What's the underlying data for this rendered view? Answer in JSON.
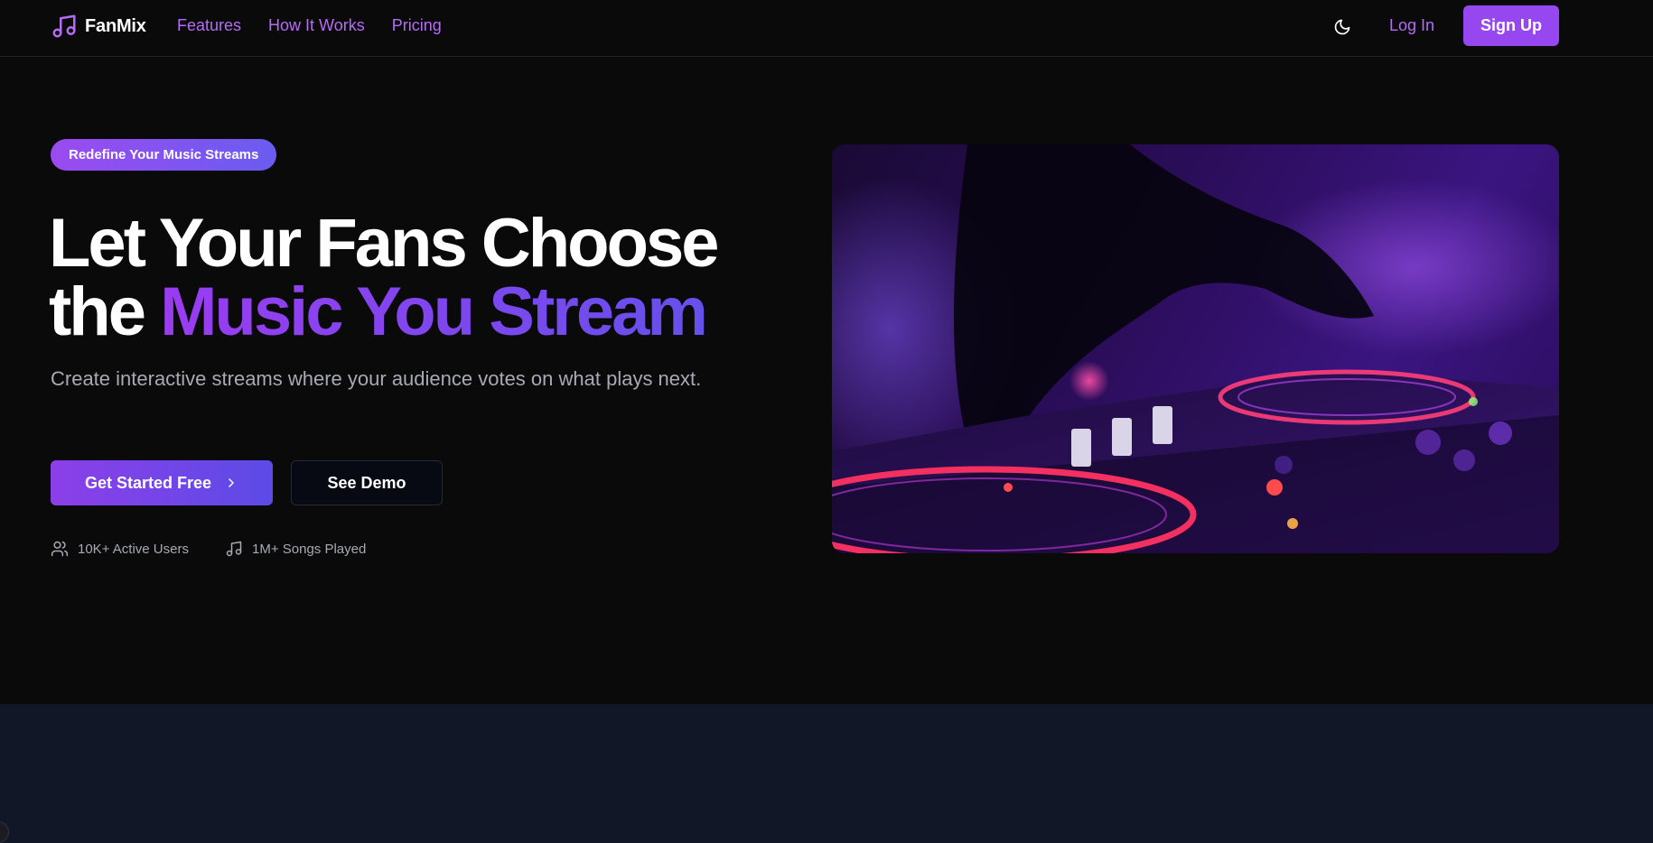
{
  "brand": {
    "name": "FanMix",
    "icon": "music-note-icon"
  },
  "nav": {
    "links": [
      "Features",
      "How It Works",
      "Pricing"
    ],
    "theme_icon": "moon-icon",
    "login_label": "Log In",
    "signup_label": "Sign Up"
  },
  "hero": {
    "badge": "Redefine Your Music Streams",
    "headline_line1": "Let Your Fans Choose",
    "headline_line2_plain": "the",
    "headline_line2_accent": "Music You Stream",
    "subtitle": "Create interactive streams where your audience votes on what plays next.",
    "cta_primary": "Get Started Free",
    "cta_primary_icon": "chevron-right-icon",
    "cta_secondary": "See Demo",
    "stats": [
      {
        "icon": "users-icon",
        "label": "10K+ Active Users"
      },
      {
        "icon": "music-note-icon",
        "label": "1M+ Songs Played"
      }
    ],
    "image_alt": "DJ mixer turntable in purple light"
  },
  "colors": {
    "background": "#0a0a0b",
    "accent": "#9747f0",
    "link": "#b46cf5",
    "muted_text": "#a7a9b4",
    "lower_section": "#111726"
  }
}
